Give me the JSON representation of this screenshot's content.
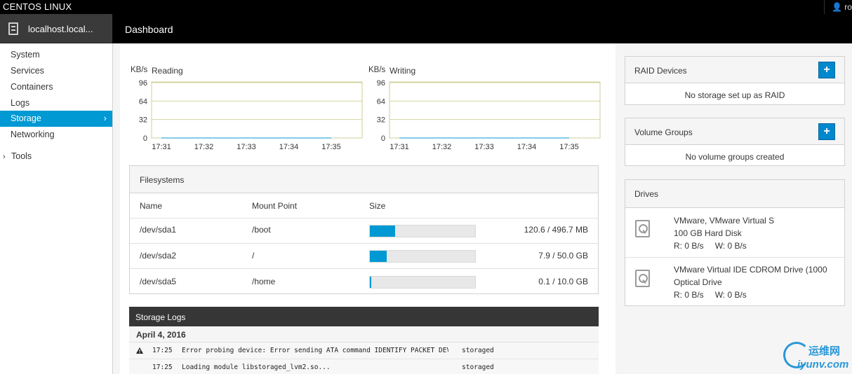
{
  "topbar": {
    "brand": "CENTOS LINUX",
    "user": "root"
  },
  "host": {
    "name": "localhost.local..."
  },
  "header": {
    "title": "Dashboard"
  },
  "sidebar": {
    "items": [
      {
        "label": "System"
      },
      {
        "label": "Services"
      },
      {
        "label": "Containers"
      },
      {
        "label": "Logs"
      },
      {
        "label": "Storage",
        "active": true
      },
      {
        "label": "Networking"
      }
    ],
    "tools_label": "Tools"
  },
  "chart_data": [
    {
      "type": "line",
      "title": "Reading",
      "ylabel": "KB/s",
      "yticks": [
        "96",
        "64",
        "32",
        "0"
      ],
      "ylim": [
        0,
        100
      ],
      "categories": [
        "17:31",
        "17:32",
        "17:33",
        "17:34",
        "17:35"
      ],
      "values": [
        0,
        0,
        0,
        0,
        0
      ]
    },
    {
      "type": "line",
      "title": "Writing",
      "ylabel": "KB/s",
      "yticks": [
        "96",
        "64",
        "32",
        "0"
      ],
      "ylim": [
        0,
        100
      ],
      "categories": [
        "17:31",
        "17:32",
        "17:33",
        "17:34",
        "17:35"
      ],
      "values": [
        0,
        0,
        0,
        0,
        0
      ]
    }
  ],
  "filesystems": {
    "title": "Filesystems",
    "columns": {
      "name": "Name",
      "mount": "Mount Point",
      "size": "Size"
    },
    "rows": [
      {
        "name": "/dev/sda1",
        "mount": "/boot",
        "size": "120.6 / 496.7 MB",
        "usage": 0.243
      },
      {
        "name": "/dev/sda2",
        "mount": "/",
        "size": "7.9 / 50.0 GB",
        "usage": 0.158
      },
      {
        "name": "/dev/sda5",
        "mount": "/home",
        "size": "0.1 / 10.0 GB",
        "usage": 0.01
      }
    ]
  },
  "logs": {
    "title": "Storage Logs",
    "date": "April 4, 2016",
    "entries": [
      {
        "warn": true,
        "time": "17:25",
        "message": "Error probing device: Error sending ATA command IDENTIFY PACKET DEV…",
        "source": "storaged"
      },
      {
        "warn": false,
        "time": "17:25",
        "message": "Loading module libstoraged_lvm2.so...",
        "source": "storaged"
      }
    ]
  },
  "raid": {
    "title": "RAID Devices",
    "empty": "No storage set up as RAID",
    "add_label": "+"
  },
  "volume_groups": {
    "title": "Volume Groups",
    "empty": "No volume groups created",
    "add_label": "+"
  },
  "drives": {
    "title": "Drives",
    "items": [
      {
        "name": "VMware, VMware Virtual S",
        "type": "100 GB Hard Disk",
        "read": "R: 0 B/s",
        "write": "W: 0 B/s"
      },
      {
        "name": "VMware Virtual IDE CDROM Drive (1000",
        "type": "Optical Drive",
        "read": "R: 0 B/s",
        "write": "W: 0 B/s"
      }
    ]
  },
  "watermark": {
    "cn": "运维网",
    "url": "iyunv.com"
  },
  "colors": {
    "accent": "#0099d3",
    "button": "#0088ce",
    "chart_grid": "#d4d4a0"
  }
}
